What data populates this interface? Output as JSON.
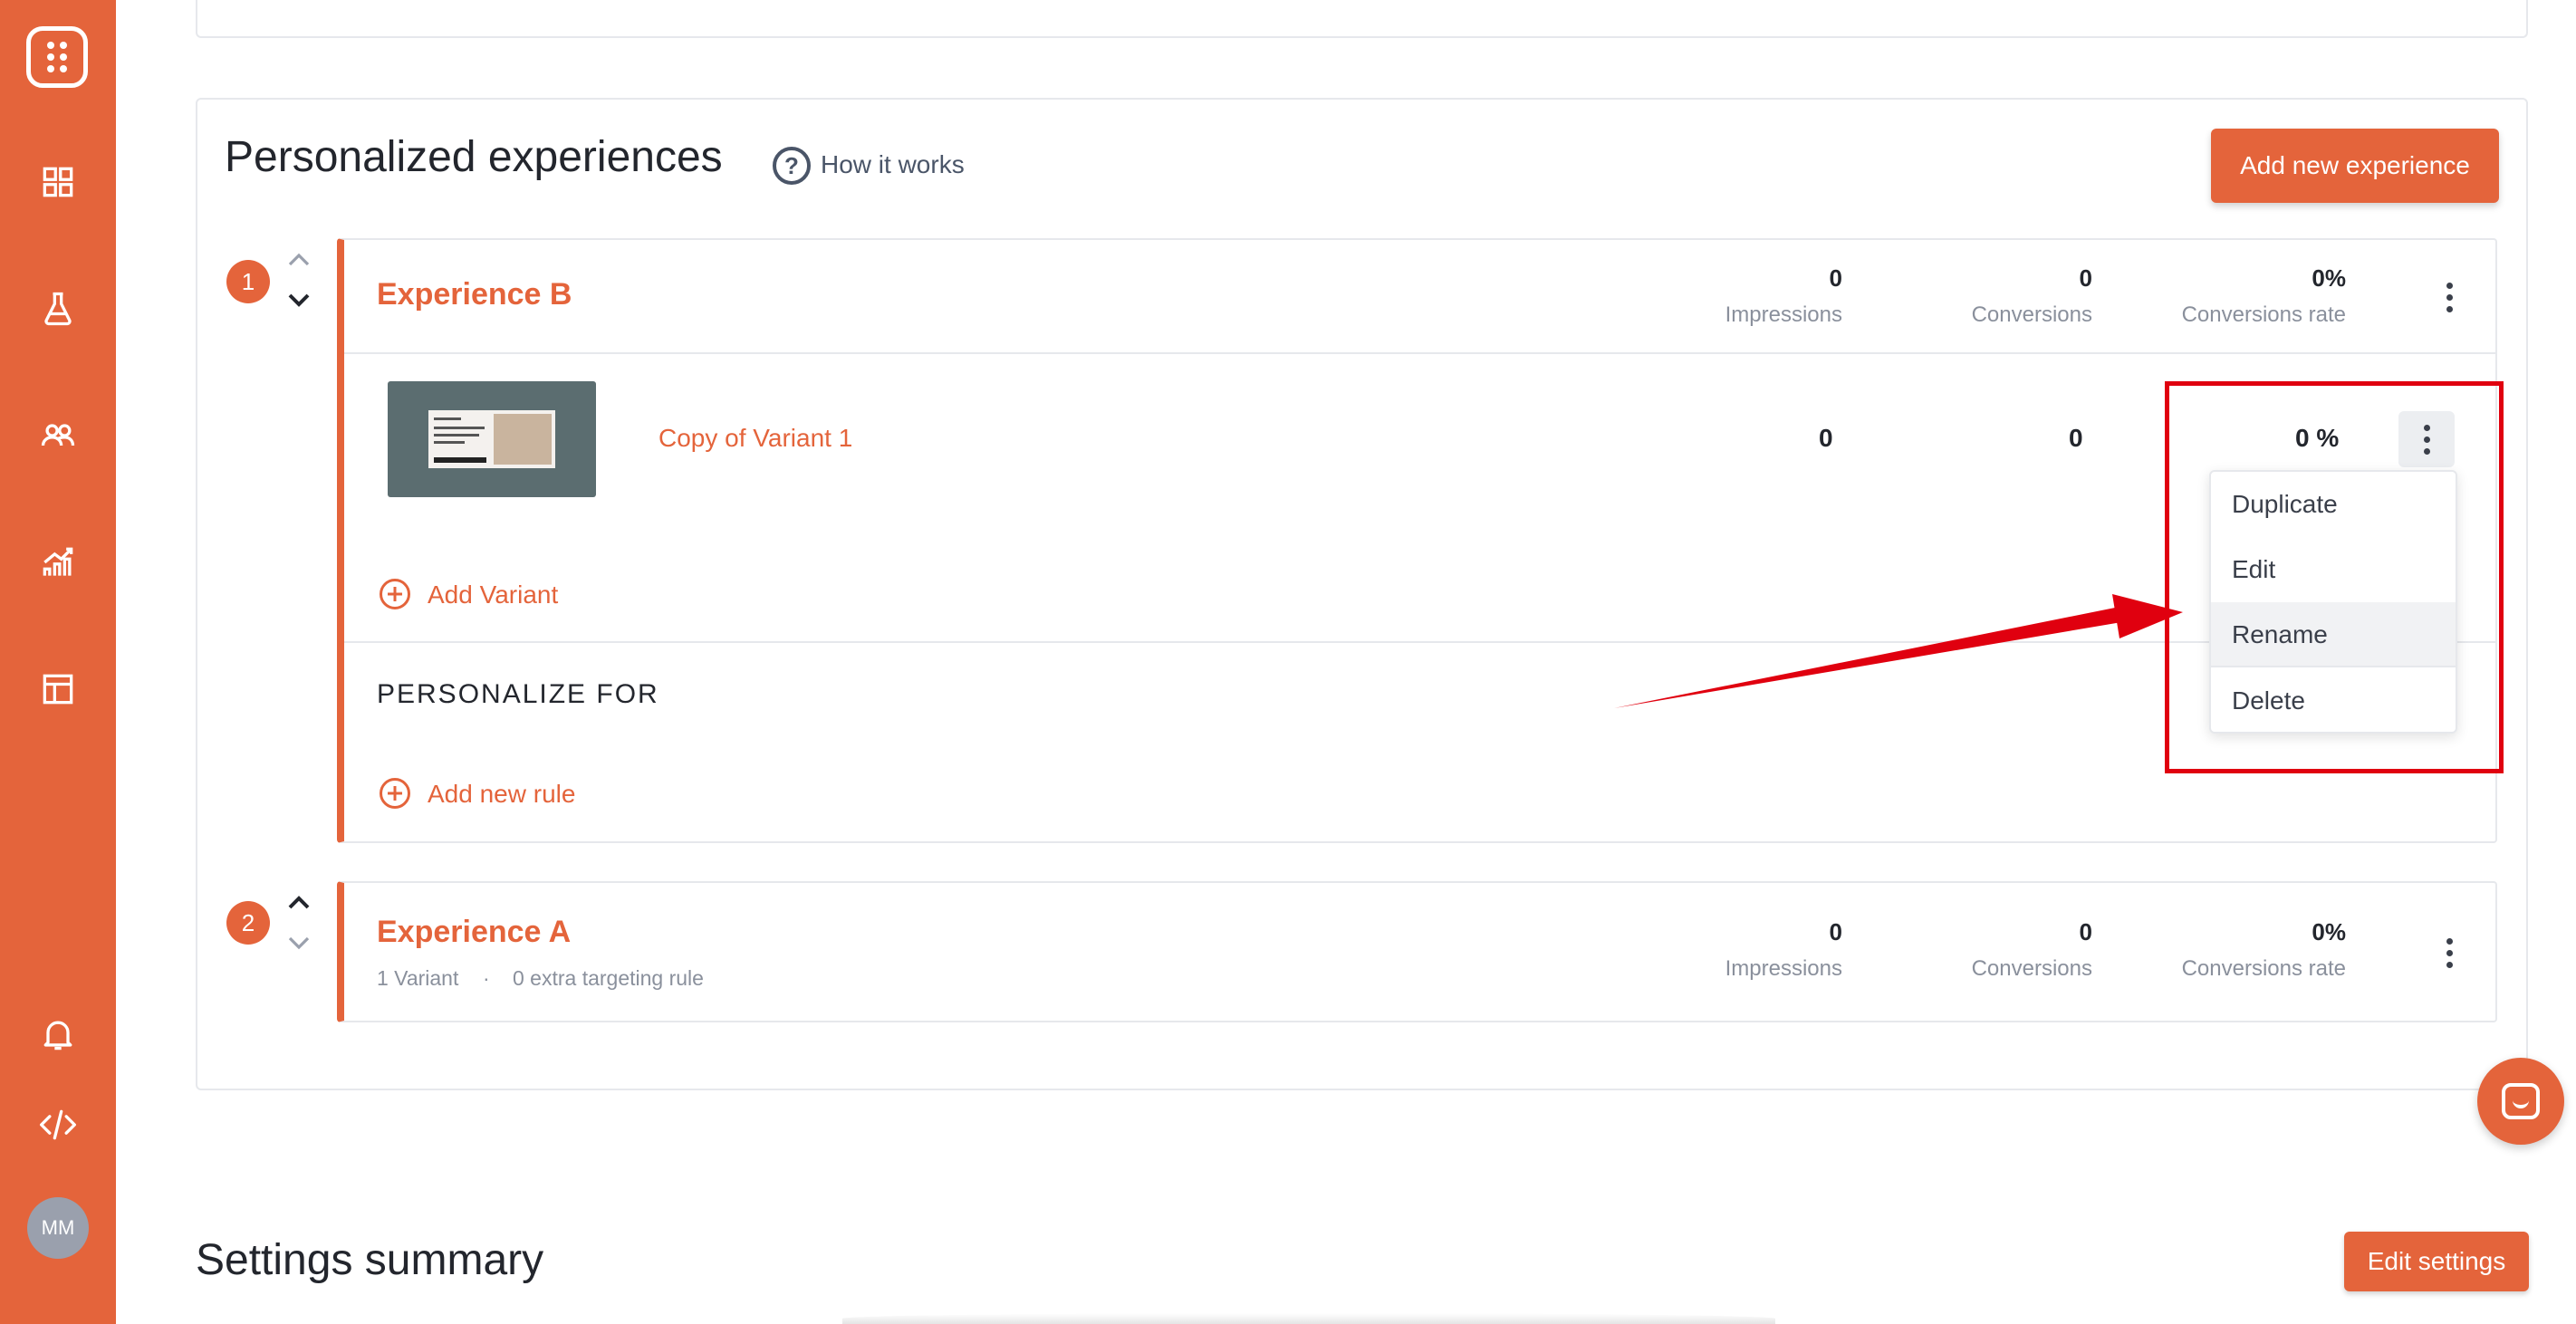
{
  "sidebar": {
    "avatar_initials": "MM",
    "icons": [
      "logo-icon",
      "dashboard-icon",
      "flask-icon",
      "users-icon",
      "analytics-icon",
      "layout-icon",
      "bell-icon",
      "code-icon"
    ]
  },
  "section": {
    "title": "Personalized experiences",
    "how_it_works": "How it works",
    "add_button": "Add new experience"
  },
  "experiences": [
    {
      "index": "1",
      "name": "Experience B",
      "impressions": "0",
      "conversions": "0",
      "conversion_rate": "0%",
      "labels": {
        "impressions": "Impressions",
        "conversions": "Conversions",
        "rate": "Conversions rate"
      },
      "variant": {
        "name": "Copy of Variant 1",
        "impressions": "0",
        "conversions": "0",
        "rate": "0 %"
      },
      "add_variant": "Add Variant",
      "personalize_for": "PERSONALIZE FOR",
      "add_rule": "Add new rule"
    },
    {
      "index": "2",
      "name": "Experience A",
      "meta_variants": "1 Variant",
      "meta_sep": "·",
      "meta_rules": "0 extra targeting rule",
      "impressions": "0",
      "conversions": "0",
      "conversion_rate": "0%",
      "labels": {
        "impressions": "Impressions",
        "conversions": "Conversions",
        "rate": "Conversions rate"
      }
    }
  ],
  "variant_menu": {
    "items": [
      "Duplicate",
      "Edit",
      "Rename",
      "Delete"
    ],
    "highlighted": "Rename"
  },
  "annotation": {
    "color": "#e0000f"
  },
  "settings": {
    "title": "Settings summary",
    "edit_button": "Edit settings"
  },
  "colors": {
    "accent": "#e4643b"
  }
}
